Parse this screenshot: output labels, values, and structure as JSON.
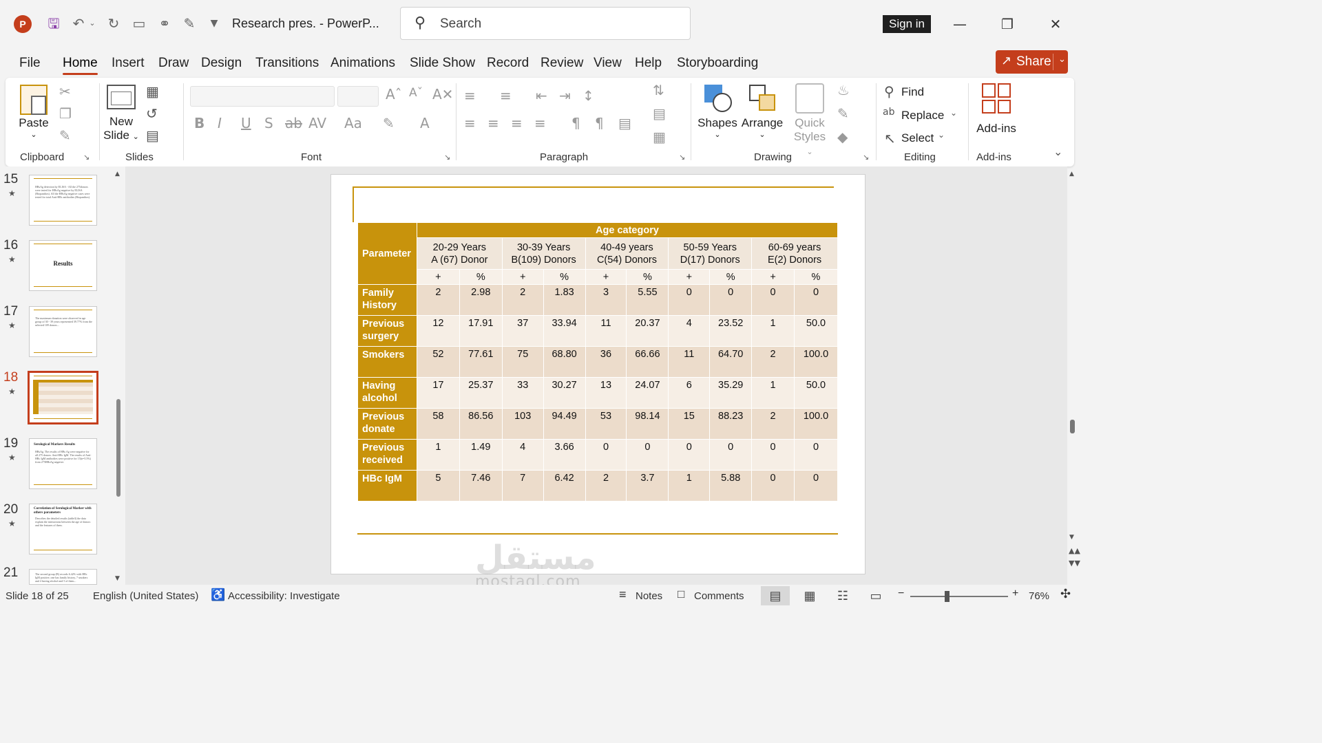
{
  "app": {
    "logo": "P",
    "doc_title": "Research pres.  -  PowerP...",
    "search_placeholder": "Search",
    "signin_label": "Sign in",
    "share_label": "Share"
  },
  "menu": {
    "tabs": [
      "File",
      "Home",
      "Insert",
      "Draw",
      "Design",
      "Transitions",
      "Animations",
      "Slide Show",
      "Record",
      "Review",
      "View",
      "Help",
      "Storyboarding"
    ],
    "active": "Home"
  },
  "ribbon": {
    "clipboard": {
      "paste": "Paste",
      "label": "Clipboard"
    },
    "slides": {
      "new_slide_1": "New",
      "new_slide_2": "Slide",
      "label": "Slides"
    },
    "font": {
      "label": "Font"
    },
    "paragraph": {
      "label": "Paragraph"
    },
    "drawing": {
      "shapes": "Shapes",
      "arrange": "Arrange",
      "quick_1": "Quick",
      "quick_2": "Styles",
      "label": "Drawing"
    },
    "editing": {
      "find": "Find",
      "replace": "Replace",
      "select": "Select",
      "label": "Editing"
    },
    "addins": {
      "addins": "Add-ins",
      "label": "Add-ins"
    }
  },
  "thumbnails": [
    {
      "num": "15",
      "text": "HBsAg detection by ELISA - All the 275donors were tested for HBsAg negative by ELISA (Biopanthos). All the HBsAg negative cases were tested for total Anti-HBc antibodies (Biopanthos)."
    },
    {
      "num": "16",
      "title": "Results"
    },
    {
      "num": "17",
      "text": "The maximum donation were observed in age group of 30 - 39 years represented 39.77% from the selected 109 donors..."
    },
    {
      "num": "18",
      "selected": true
    },
    {
      "num": "19",
      "title": "Serological Markers Results",
      "text": "HBsAg. The results of HBs Ag were negative for all 275 donors. Anti-HBc IgM. The results of Anti-HBc IgM antibodies were positive for 15(n=5.5%) from 275HBsAg negative."
    },
    {
      "num": "20",
      "title": "Correlation of Serological Marker with others parameters",
      "text": "Describes the detailed results (table3) the data explain the interactions between the age of donors and the features of them."
    },
    {
      "num": "21",
      "text": "The second group (B) records 6.42% with HBc IgM positive, one has family history, 7 smokers and 4 having alcohol and 5 of them..."
    }
  ],
  "table": {
    "age_category": "Age category",
    "parameter": "Parameter",
    "groups": [
      {
        "line1": "20-29 Years",
        "line2": "A (67) Donor"
      },
      {
        "line1": "30-39 Years",
        "line2": "B(109) Donors"
      },
      {
        "line1": "40-49 years",
        "line2": "C(54) Donors"
      },
      {
        "line1": "50-59 Years",
        "line2": "D(17) Donors"
      },
      {
        "line1": "60-69 years",
        "line2": "E(2) Donors"
      }
    ],
    "subheaders": [
      "+",
      "%",
      "+",
      "%",
      "+",
      "%",
      "+",
      "%",
      "+",
      "%"
    ],
    "rows": [
      {
        "label": "Family History",
        "values": [
          "2",
          "2.98",
          "2",
          "1.83",
          "3",
          "5.55",
          "0",
          "0",
          "0",
          "0"
        ]
      },
      {
        "label": "Previous surgery",
        "values": [
          "12",
          "17.91",
          "37",
          "33.94",
          "11",
          "20.37",
          "4",
          "23.52",
          "1",
          "50.0"
        ]
      },
      {
        "label": "Smokers",
        "values": [
          "52",
          "77.61",
          "75",
          "68.80",
          "36",
          "66.66",
          "11",
          "64.70",
          "2",
          "100.0"
        ]
      },
      {
        "label": "Having alcohol",
        "values": [
          "17",
          "25.37",
          "33",
          "30.27",
          "13",
          "24.07",
          "6",
          "35.29",
          "1",
          "50.0"
        ]
      },
      {
        "label": "Previous donate",
        "values": [
          "58",
          "86.56",
          "103",
          "94.49",
          "53",
          "98.14",
          "15",
          "88.23",
          "2",
          "100.0"
        ]
      },
      {
        "label": "Previous received",
        "values": [
          "1",
          "1.49",
          "4",
          "3.66",
          "0",
          "0",
          "0",
          "0",
          "0",
          "0"
        ]
      },
      {
        "label": "HBc IgM",
        "values": [
          "5",
          "7.46",
          "7",
          "6.42",
          "2",
          "3.7",
          "1",
          "5.88",
          "0",
          "0"
        ]
      }
    ]
  },
  "watermark": {
    "arabic": "مستقل",
    "latin": "mostaql.com"
  },
  "status": {
    "slide": "Slide 18 of 25",
    "language": "English (United States)",
    "accessibility": "Accessibility: Investigate",
    "notes": "Notes",
    "comments": "Comments",
    "zoom": "76%"
  },
  "colors": {
    "accent": "#c43e1c",
    "table_gold": "#c8930c"
  }
}
